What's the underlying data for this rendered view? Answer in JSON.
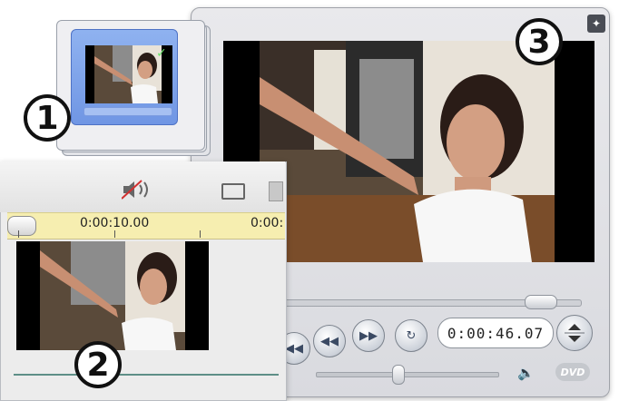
{
  "callouts": {
    "one": "1",
    "two": "2",
    "three": "3"
  },
  "album": {
    "checkmark_icon": "checkmark-icon"
  },
  "timeline": {
    "ruler_label_1": "0:00:10.00",
    "ruler_label_2": "0:00:",
    "audio_icon": "speaker-muted-icon",
    "split_icon": "split-clip-icon",
    "trash_icon": "trash-icon"
  },
  "player": {
    "pin_icon": "pin-icon",
    "timecode": "0:00:46.07",
    "volume_icon": "speaker-icon",
    "dvd_label": "DVD",
    "buttons": [
      "go-to-start",
      "rewind",
      "fast-forward",
      "loop"
    ]
  },
  "colors": {
    "selection_blue": "#7096e4",
    "ruler_yellow": "#f6eeb0",
    "track_teal": "#5e8f87"
  }
}
